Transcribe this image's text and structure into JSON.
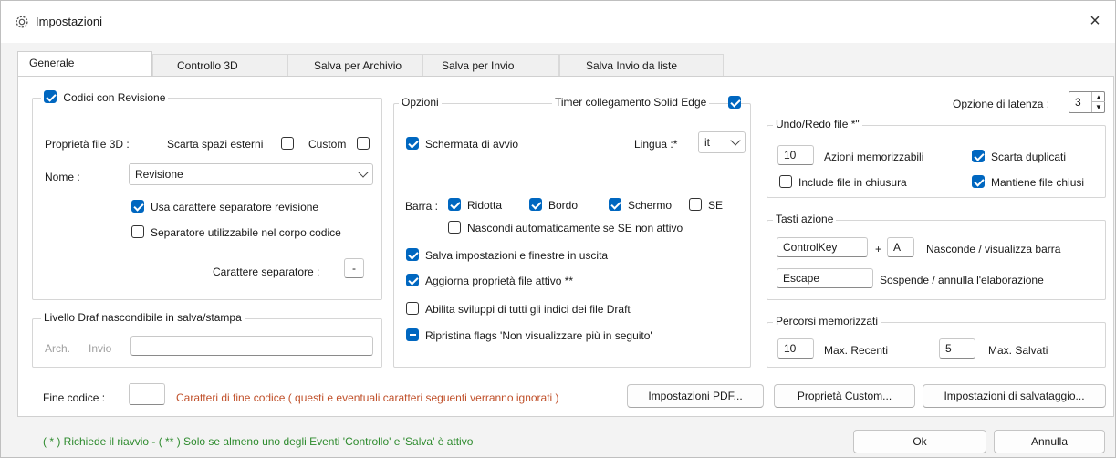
{
  "window": {
    "title": "Impostazioni"
  },
  "tabs": [
    "Generale",
    "Controllo 3D",
    "Salva per Archivio",
    "Salva per Invio",
    "Salva Invio da liste"
  ],
  "codici": {
    "group_label": "Codici con Revisione",
    "proprieta_label": "Proprietà file 3D :",
    "scarta_label": "Scarta spazi esterni",
    "custom_label": "Custom",
    "nome_label": "Nome :",
    "nome_value": "Revisione",
    "usa_carattere": "Usa carattere separatore revisione",
    "separatore_corpo": "Separatore utilizzabile nel corpo codice",
    "carattere_label": "Carattere separatore  :",
    "carattere_value": "-"
  },
  "livello": {
    "group_label": "Livello Draf nascondibile in salva/stampa",
    "arch": "Arch.",
    "invio": "Invio",
    "value": ""
  },
  "opzioni": {
    "group_label": "Opzioni",
    "timer_label": "Timer collegamento Solid Edge",
    "schermata": "Schermata di avvio",
    "lingua_label": "Lingua :*",
    "lingua_value": "it",
    "barra_label": "Barra :",
    "ridotta": "Ridotta",
    "bordo": "Bordo",
    "schermo": "Schermo",
    "se": "SE",
    "nascondi": "Nascondi automaticamente se SE non attivo",
    "salva_imp": "Salva impostazioni e finestre in uscita",
    "aggiorna": "Aggiorna proprietà file attivo **",
    "abilita": "Abilita sviluppi di tutti gli indici dei file Draft",
    "ripristina": "Ripristina flags  'Non visualizzare più in seguito'"
  },
  "latenza": {
    "label": "Opzione di latenza :",
    "value": "3"
  },
  "undo": {
    "group_label": "Undo/Redo file *\"",
    "azioni_value": "10",
    "azioni_label": "Azioni memorizzabili",
    "scarta_dup": "Scarta duplicati",
    "include": "Include file in chiusura",
    "mantiene": "Mantiene file chiusi"
  },
  "tasti": {
    "group_label": "Tasti azione",
    "key1": "ControlKey",
    "plus": "+",
    "key1b": "A",
    "desc1": "Nasconde / visualizza barra",
    "key2": "Escape",
    "desc2": "Sospende / annulla l'elaborazione"
  },
  "percorsi": {
    "group_label": "Percorsi memorizzati",
    "recenti_value": "10",
    "recenti_label": "Max. Recenti",
    "salvati_value": "5",
    "salvati_label": "Max. Salvati"
  },
  "fine": {
    "label": "Fine codice :",
    "value": "",
    "desc": "Caratteri di fine codice ( questi e eventuali caratteri seguenti verranno ignorati )"
  },
  "buttons": {
    "pdf": "Impostazioni PDF...",
    "custom": "Proprietà Custom...",
    "salvataggio": "Impostazioni di salvataggio...",
    "ok": "Ok",
    "annulla": "Annulla"
  },
  "footer_note": "( * ) Richiede il riavvio - ( ** ) Solo se almeno uno degli Eventi 'Controllo' e 'Salva' è attivo",
  "colors": {
    "accent": "#0067c0",
    "note_red": "#c0502a",
    "note_green": "#2e8b2e"
  }
}
